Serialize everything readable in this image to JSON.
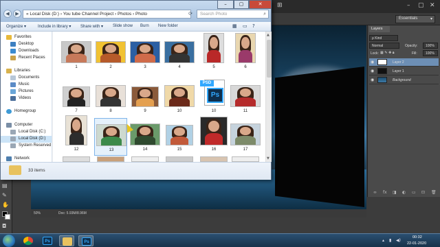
{
  "explorer": {
    "breadcrumb": "« Local Disk (D:) › You tube Channel  Project › Photos › Photo",
    "search_placeholder": "Search Photo",
    "toolbar": {
      "organize": "Organize ▾",
      "include": "Include in library ▾",
      "share": "Share with ▾",
      "slideshow": "Slide show",
      "burn": "Burn",
      "new_folder": "New folder"
    },
    "nav": {
      "favorites": "Favorites",
      "desktop": "Desktop",
      "downloads": "Downloads",
      "recent": "Recent Places",
      "libraries": "Libraries",
      "documents": "Documents",
      "music": "Music",
      "pictures": "Pictures",
      "videos": "Videos",
      "homegroup": "Homegroup",
      "computer": "Computer",
      "disk_c": "Local Disk (C:)",
      "disk_d": "Local Disk (D:)",
      "system_reserved": "System Reserved",
      "network": "Network"
    },
    "items": [
      {
        "label": "1"
      },
      {
        "label": "2"
      },
      {
        "label": "3"
      },
      {
        "label": "4"
      },
      {
        "label": "5"
      },
      {
        "label": "6"
      },
      {
        "label": "7"
      },
      {
        "label": "8"
      },
      {
        "label": "9"
      },
      {
        "label": "10"
      },
      {
        "label": "10"
      },
      {
        "label": "11"
      },
      {
        "label": "12"
      },
      {
        "label": "13"
      },
      {
        "label": "14"
      },
      {
        "label": "15"
      },
      {
        "label": "16"
      },
      {
        "label": "17"
      }
    ],
    "psd_badge": "PSD",
    "psd_logo": "Ps",
    "status_count": "33 items"
  },
  "photoshop": {
    "workspace": "Essentials",
    "layers": {
      "tab": "Layers",
      "kind": "ρ Kind",
      "blend_mode": "Normal",
      "opacity_label": "Opacity:",
      "opacity_value": "100%",
      "lock_label": "Lock:",
      "fill_label": "Fill:",
      "fill_value": "100%",
      "rows": [
        {
          "name": "Layer 2"
        },
        {
          "name": "Layer 1"
        },
        {
          "name": "Background"
        }
      ]
    },
    "status": {
      "zoom": "50%",
      "doc": "Doc: 5.93M/8.96M"
    }
  },
  "taskbar": {
    "photoshop_label": "Ps",
    "time": "00:32",
    "date": "22-01-2020"
  }
}
